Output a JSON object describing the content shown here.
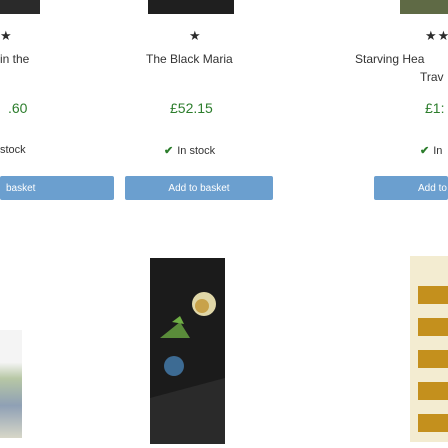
{
  "products": [
    {
      "stars": "★",
      "title_lines": [
        "in the"
      ],
      "price": ".60",
      "stock": "stock",
      "button": "basket"
    },
    {
      "stars": "★",
      "title_lines": [
        "The Black Maria"
      ],
      "price": "£52.15",
      "stock": "In stock",
      "button": "Add to basket"
    },
    {
      "stars": "★★",
      "title_lines": [
        "Starving Hea",
        "Trav"
      ],
      "price": "£1:",
      "stock": "In",
      "button": "Add to"
    }
  ],
  "colors": {
    "button": "#6b9fcf",
    "price": "#2c7d2c",
    "check": "#2c7d2c"
  },
  "icons": {
    "check": "check-icon",
    "star": "star-icon"
  }
}
